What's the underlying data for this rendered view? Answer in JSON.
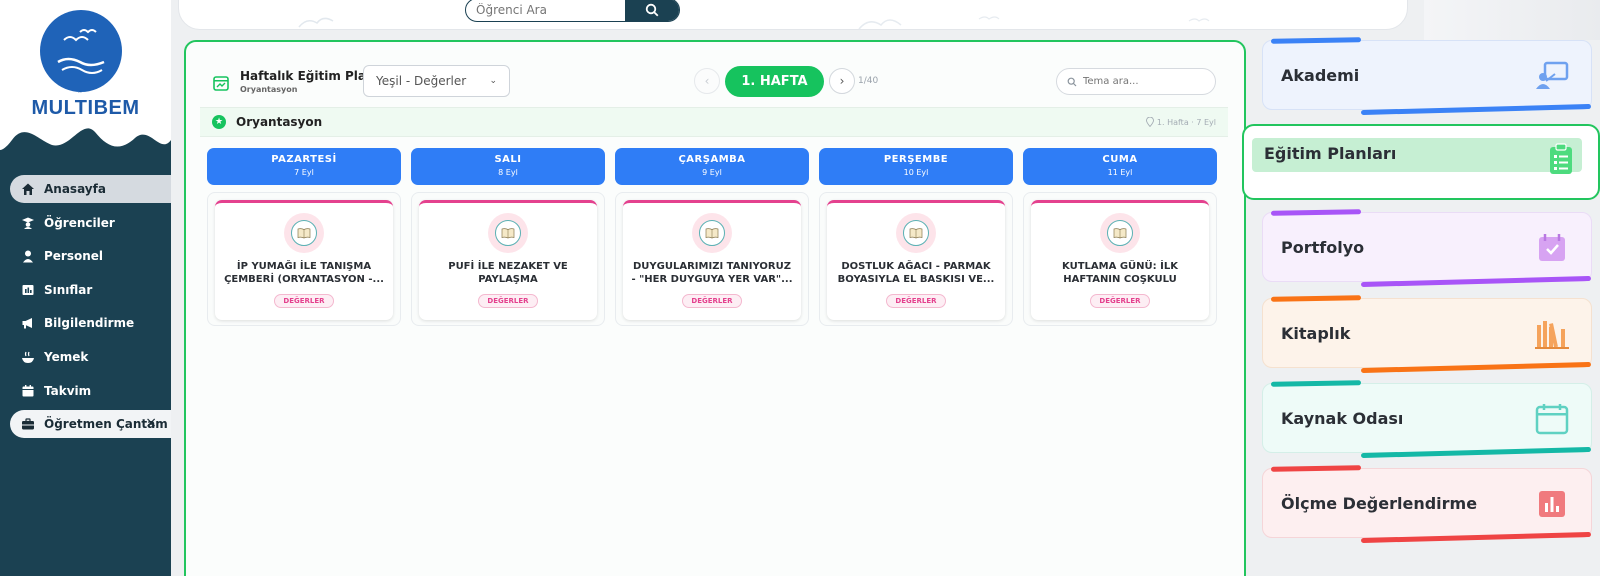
{
  "brand": {
    "name": "MULTIBEM",
    "mark": "⌃"
  },
  "sidebar": {
    "items": [
      {
        "label": "Anasayfa",
        "icon": "home-icon",
        "active": true
      },
      {
        "label": "Öğrenciler",
        "icon": "students-icon"
      },
      {
        "label": "Personel",
        "icon": "staff-icon"
      },
      {
        "label": "Sınıflar",
        "icon": "classes-icon"
      },
      {
        "label": "Bilgilendirme",
        "icon": "megaphone-icon"
      },
      {
        "label": "Yemek",
        "icon": "meal-icon"
      },
      {
        "label": "Takvim",
        "icon": "calendar-icon"
      },
      {
        "label": "Öğretmen Çantam",
        "icon": "briefcase-icon",
        "close": "×"
      }
    ]
  },
  "topbar": {
    "search_placeholder": "Öğrenci Ara"
  },
  "plan": {
    "title": "Haftalık Eğitim Planı",
    "subtitle": "Oryantasyon",
    "theme_select": "Yeşil - Değerler",
    "week_label": "1. HAFTA",
    "page_count": "1/40",
    "topic_search_placeholder": "Tema ara...",
    "section_title": "Oryantasyon",
    "section_meta": "1. Hafta · 7 Eyl"
  },
  "days": [
    {
      "name": "PAZARTESİ",
      "date": "7 Eyl",
      "activity": "İP YUMAĞI İLE TANIŞMA ÇEMBERİ (ORYANTASYON -...",
      "tag": "DEĞERLER"
    },
    {
      "name": "SALI",
      "date": "8 Eyl",
      "activity": "PUFİ İLE NEZAKET VE PAYLAŞMA",
      "tag": "DEĞERLER"
    },
    {
      "name": "ÇARŞAMBA",
      "date": "9 Eyl",
      "activity": "DUYGULARIMIZI TANIYORUZ - \"HER DUYGUYA YER VAR\"...",
      "tag": "DEĞERLER"
    },
    {
      "name": "PERŞEMBE",
      "date": "10 Eyl",
      "activity": "DOSTLUK AĞACI - PARMAK BOYASIYLA EL BASKISI VE...",
      "tag": "DEĞERLER"
    },
    {
      "name": "CUMA",
      "date": "11 Eyl",
      "activity": "KUTLAMA GÜNÜ: İLK HAFTANIN COŞKULU KAPANIŞI",
      "tag": "DEĞERLER"
    }
  ],
  "right_cards": {
    "akademi": "Akademi",
    "egitim": "Eğitim Planları",
    "portfolyo": "Portfolyo",
    "kitaplik": "Kitaplık",
    "kaynak": "Kaynak Odası",
    "olcme": "Ölçme Değerlendirme"
  },
  "colors": {
    "sidebar": "#1b4152",
    "accent_green": "#22c55e",
    "day_header": "#2f7df6",
    "tag_pink": "#e4418e"
  }
}
